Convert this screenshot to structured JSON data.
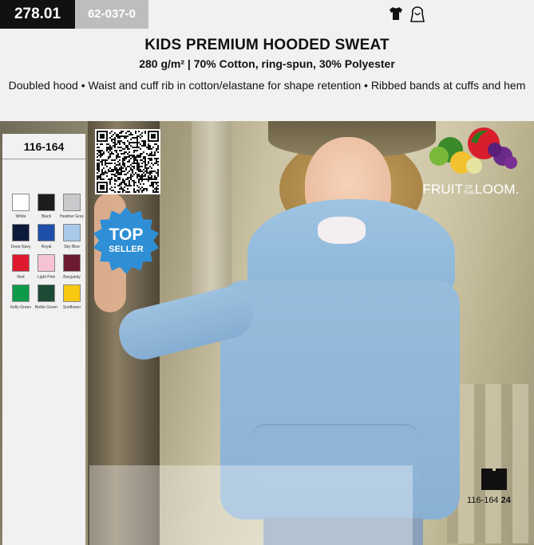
{
  "header": {
    "article_number": "278.01",
    "supplier_code": "62-037-0",
    "icons": [
      "tshirt-icon",
      "hood-icon"
    ],
    "title": "KIDS PREMIUM HOODED SWEAT",
    "subtitle": "280 g/m² | 70% Cotton, ring-spun, 30% Polyester",
    "description": "Doubled hood • Waist and cuff rib in cotton/elastane for shape retention • Ribbed bands at cuffs and hem"
  },
  "sizes": "116-164",
  "colors": [
    {
      "name": "White",
      "hex": "#ffffff"
    },
    {
      "name": "Black",
      "hex": "#1c1c1c"
    },
    {
      "name": "Heather Grey",
      "hex": "#c8c9cb"
    },
    {
      "name": "Deep Navy",
      "hex": "#0d1b3a"
    },
    {
      "name": "Royal",
      "hex": "#1f4fa8"
    },
    {
      "name": "Sky Blue",
      "hex": "#a9c9ea"
    },
    {
      "name": "Red",
      "hex": "#e01a2e"
    },
    {
      "name": "Light Pink",
      "hex": "#f6c3d3"
    },
    {
      "name": "Burgundy",
      "hex": "#6e1a33"
    },
    {
      "name": "Kelly Green",
      "hex": "#0f9a4a"
    },
    {
      "name": "Bottle Green",
      "hex": "#1d4a34"
    },
    {
      "name": "Sunflower",
      "hex": "#f8c812"
    }
  ],
  "badge": {
    "line1": "TOP",
    "line2": "SELLER",
    "color": "#2e8fd6"
  },
  "brand": {
    "name": "FRUIT",
    "of": "OF",
    "the": "THE",
    "loom": "LOOM."
  },
  "pack": {
    "sizes": "116-164",
    "quantity": "24"
  }
}
